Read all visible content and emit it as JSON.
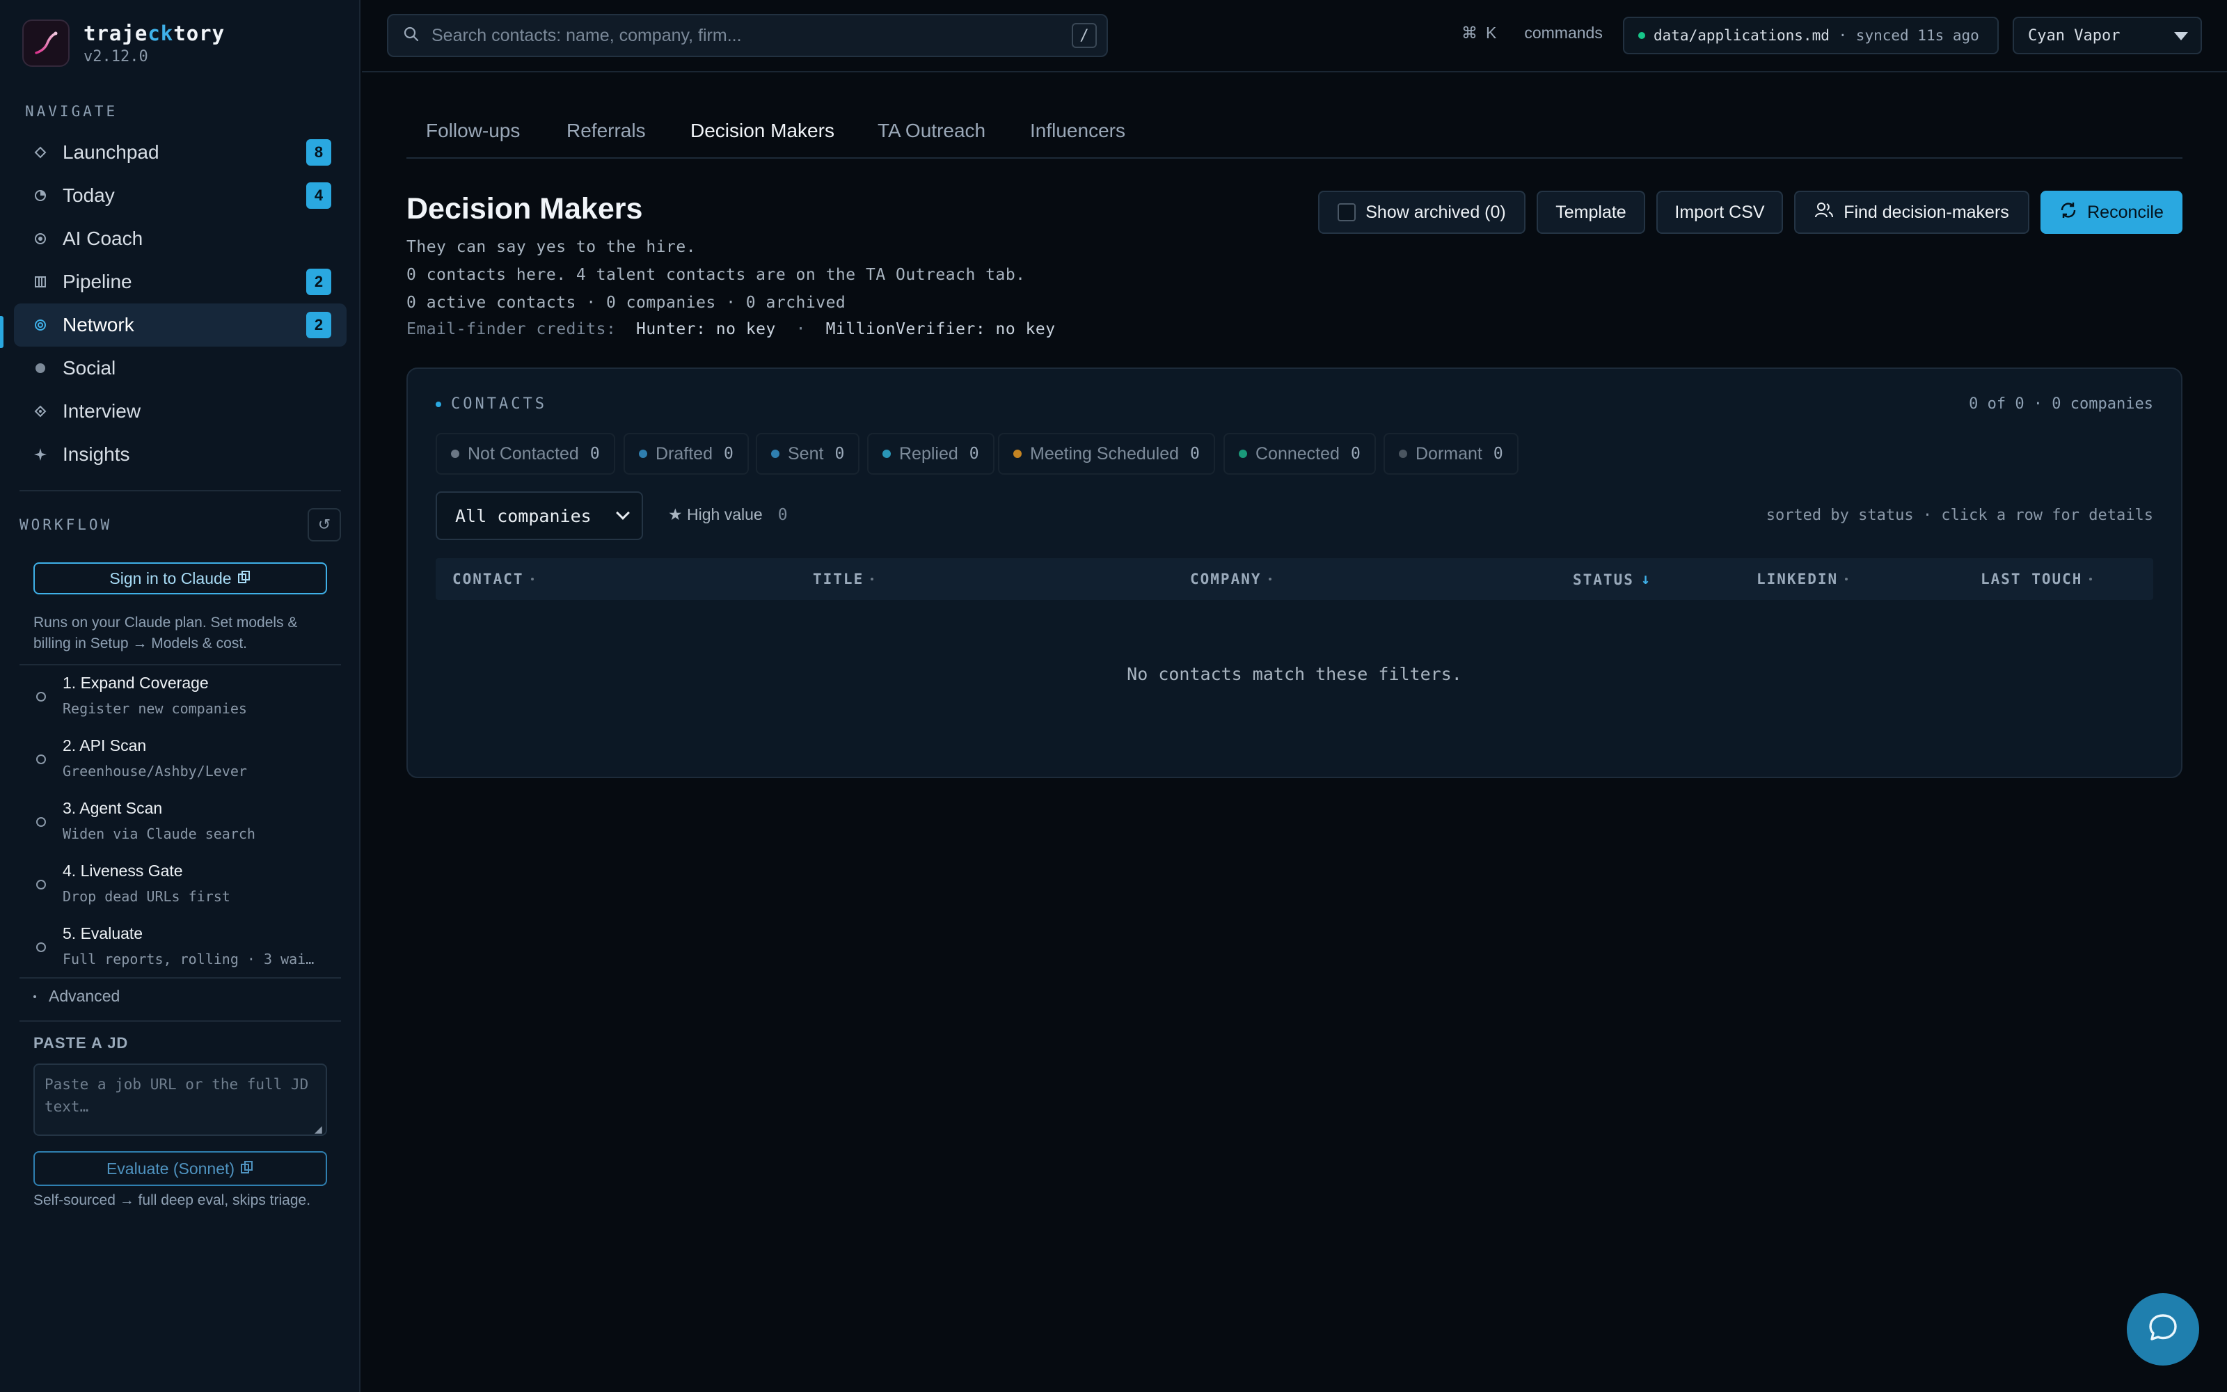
{
  "app": {
    "name_prefix": "traje",
    "name_highlight": "ck",
    "name_suffix": "tory",
    "version": "v2.12.0"
  },
  "sidebar": {
    "navigate_label": "NAVIGATE",
    "nav_items": [
      {
        "label": "Launchpad",
        "icon": "diamond-icon",
        "badge": "8"
      },
      {
        "label": "Today",
        "icon": "clock-icon",
        "badge": "4"
      },
      {
        "label": "AI Coach",
        "icon": "target-icon",
        "badge": ""
      },
      {
        "label": "Pipeline",
        "icon": "columns-icon",
        "badge": "2"
      },
      {
        "label": "Network",
        "icon": "network-icon",
        "badge": "2",
        "active": true
      },
      {
        "label": "Social",
        "icon": "circle-icon",
        "badge": ""
      },
      {
        "label": "Interview",
        "icon": "diamond-icon",
        "badge": ""
      },
      {
        "label": "Insights",
        "icon": "sparkle-icon",
        "badge": ""
      }
    ],
    "workflow_label": "WORKFLOW",
    "signin_label": "Sign in to Claude",
    "plan_note_line1": "Runs on your Claude plan. Set models &",
    "plan_note_line2": "billing in Setup → Models & cost.",
    "steps": [
      {
        "title": "1. Expand Coverage",
        "desc": "Register new companies"
      },
      {
        "title": "2. API Scan",
        "desc": "Greenhouse/Ashby/Lever"
      },
      {
        "title": "3. Agent Scan",
        "desc": "Widen via Claude search"
      },
      {
        "title": "4. Liveness Gate",
        "desc": "Drop dead URLs first"
      },
      {
        "title": "5. Evaluate",
        "desc": "Full reports, rolling · 3 wai…"
      }
    ],
    "advanced_label": "Advanced",
    "paste_label": "PASTE A JD",
    "jd_placeholder": "Paste a job URL or the full JD text…",
    "evaluate_label": "Evaluate (Sonnet)",
    "evaluate_note": "Self-sourced → full deep eval, skips triage."
  },
  "topbar": {
    "search_placeholder": "Search contacts: name, company, firm...",
    "search_shortcut": "/",
    "cmd_symbol": "⌘",
    "cmd_key": "K",
    "cmd_label": "commands",
    "sync_path": "data/applications.md",
    "sync_status": " · synced 11s ago",
    "sync_color": "#16c78a",
    "theme": "Cyan Vapor"
  },
  "tabs": [
    "Follow-ups",
    "Referrals",
    "Decision Makers",
    "TA Outreach",
    "Influencers"
  ],
  "active_tab": "Decision Makers",
  "page": {
    "title": "Decision Makers",
    "line1": "They can say yes to the hire.",
    "line2": "0 contacts here. 4 talent contacts are on the TA Outreach tab.",
    "line3": "0 active contacts · 0 companies · 0 archived",
    "credits_label": "Email-finder credits:",
    "hunter": "Hunter: no key",
    "credits_sep": "·",
    "million": "MillionVerifier: no key"
  },
  "actions": {
    "show_archived": "Show archived (0)",
    "template": "Template",
    "import_csv": "Import CSV",
    "find": "Find decision-makers",
    "reconcile": "Reconcile"
  },
  "contacts": {
    "label": "CONTACTS",
    "count": "0 of 0 · 0 companies",
    "status_chips": [
      {
        "label": "Not Contacted",
        "count": "0",
        "color": "#6b7785"
      },
      {
        "label": "Drafted",
        "count": "0",
        "color": "#2f7fb0"
      },
      {
        "label": "Sent",
        "count": "0",
        "color": "#2f7fb0"
      },
      {
        "label": "Replied",
        "count": "0",
        "color": "#2a96b8"
      },
      {
        "label": "Meeting Scheduled",
        "count": "0",
        "color": "#c58422"
      },
      {
        "label": "Connected",
        "count": "0",
        "color": "#1a9a7a"
      },
      {
        "label": "Dormant",
        "count": "0",
        "color": "#4a5560"
      }
    ],
    "company_filter": "All companies",
    "high_value_label": "★ High value",
    "high_value_count": "0",
    "sort_note": "sorted by status · click a row for details",
    "columns": [
      "CONTACT",
      "TITLE",
      "COMPANY",
      "STATUS",
      "LINKEDIN",
      "LAST TOUCH"
    ],
    "sorted_column": "STATUS",
    "empty_message": "No contacts match these filters."
  }
}
